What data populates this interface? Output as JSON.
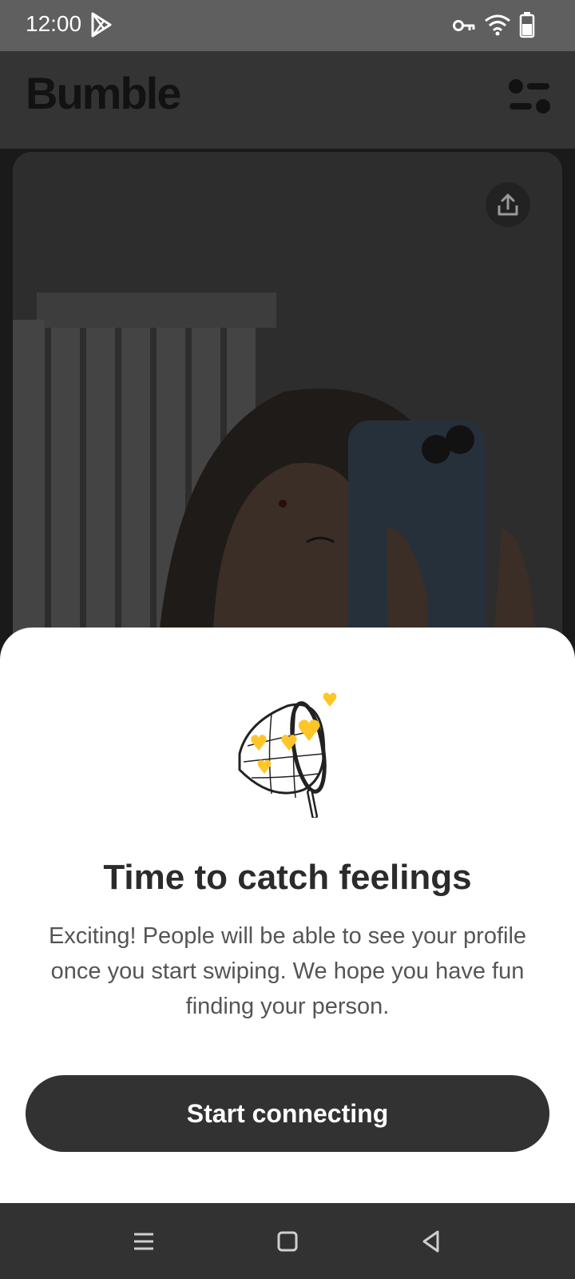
{
  "status_bar": {
    "time": "12:00",
    "icons": [
      "play-store-icon",
      "vpn-key-icon",
      "wifi-icon",
      "battery-icon"
    ]
  },
  "header": {
    "brand": "Bumble",
    "filter_icon": "filter-icon"
  },
  "card": {
    "share_icon": "share-icon"
  },
  "sheet": {
    "illustration": "butterfly-net-hearts",
    "title": "Time to catch feelings",
    "body": "Exciting! People will be able to see your profile once you start swiping. We hope you have fun finding your person.",
    "button_label": "Start connecting"
  },
  "nav_bar": {
    "buttons": [
      "menu-icon",
      "home-icon",
      "back-icon"
    ]
  },
  "colors": {
    "accent": "#FFC629",
    "button_bg": "#323232",
    "sheet_bg": "#FFFFFF"
  }
}
